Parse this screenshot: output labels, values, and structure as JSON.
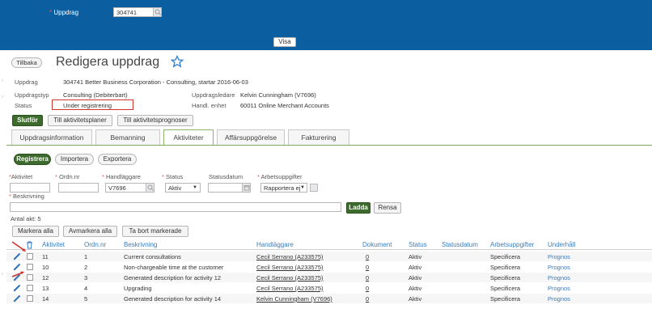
{
  "topbar": {
    "assignment_label": "Uppdrag",
    "assignment_value": "304741",
    "show_button": "Visa"
  },
  "header": {
    "back_button": "Tillbaka",
    "title": "Redigera uppdrag"
  },
  "details": {
    "assignment_label": "Uppdrag",
    "assignment_value": "304741 Better Business Corporation - Consulting, startar 2016-06-03",
    "type_label": "Uppdragstyp",
    "type_value": "Consulting (Debiterbart)",
    "status_label": "Status",
    "status_value": "Under registrering",
    "leader_label": "Uppdragsledare",
    "leader_value": "Kelvin Cunningham (V7696)",
    "unit_label": "Handl. enhet",
    "unit_value": "60011 Online Merchant Accounts"
  },
  "actions": {
    "finish": "Slutför",
    "to_activity_plans": "Till aktivitetsplaner",
    "to_activity_forecasts": "Till aktivitetsprognoser"
  },
  "tabs": [
    "Uppdragsinformation",
    "Bemanning",
    "Aktiviteter",
    "Affärsuppgörelse",
    "Fakturering"
  ],
  "subactions": {
    "register": "Registrera",
    "import": "Importera",
    "export": "Exportera"
  },
  "filters": {
    "activity_label": "Aktivitet",
    "orderno_label": "Ordn.nr",
    "handler_label": "Handläggare",
    "handler_value": "V7696",
    "status_label": "Status",
    "status_value": "Aktiv",
    "statusdate_label": "Statusdatum",
    "tasks_label": "Arbetsuppgifter",
    "tasks_value": "Rapportera ej",
    "description_label": "Beskrivning",
    "load_button": "Ladda",
    "clear_button": "Rensa"
  },
  "count_text": "Antal akt: 5",
  "table_actions": {
    "mark_all": "Markera alla",
    "unmark_all": "Avmarkera alla",
    "remove_marked": "Ta bort markerade"
  },
  "table": {
    "columns": [
      "Aktivitet",
      "Ordn.nr",
      "Beskrivning",
      "Handläggare",
      "Dokument",
      "Status",
      "Statusdatum",
      "Arbetsuppgifter",
      "Underhåll"
    ],
    "rows": [
      {
        "activity": "11",
        "order": "1",
        "description": "Current consultations",
        "handler": "Cecil Serrano (A233575)",
        "documents": "0",
        "status": "Aktiv",
        "statusdate": "",
        "tasks": "Specificera",
        "maintenance": "Prognos"
      },
      {
        "activity": "10",
        "order": "2",
        "description": "Non-chargeable time at the customer",
        "handler": "Cecil Serrano (A233575)",
        "documents": "0",
        "status": "Aktiv",
        "statusdate": "",
        "tasks": "Specificera",
        "maintenance": "Prognos"
      },
      {
        "activity": "12",
        "order": "3",
        "description": "Generated description for activity 12",
        "handler": "Cecil Serrano (A233575)",
        "documents": "0",
        "status": "Aktiv",
        "statusdate": "",
        "tasks": "Specificera",
        "maintenance": "Prognos"
      },
      {
        "activity": "13",
        "order": "4",
        "description": "Upgrading",
        "handler": "Cecil Serrano (A233575)",
        "documents": "0",
        "status": "Aktiv",
        "statusdate": "",
        "tasks": "Specificera",
        "maintenance": "Prognos"
      },
      {
        "activity": "14",
        "order": "5",
        "description": "Generated description for activity 14",
        "handler": "Kelvin Cunningham (V7696)",
        "documents": "0",
        "status": "Aktiv",
        "statusdate": "",
        "tasks": "Specificera",
        "maintenance": "Prognos"
      }
    ]
  },
  "colors": {
    "header_blue": "#0b5ea0",
    "accent_green": "#3d6b2d",
    "link_blue": "#3a7dbf",
    "status_highlight": "#d0332b"
  }
}
